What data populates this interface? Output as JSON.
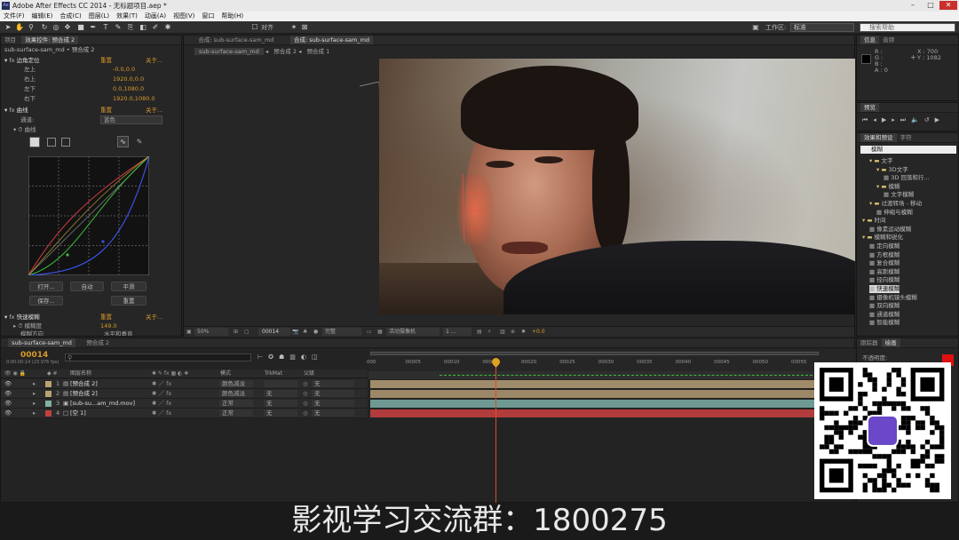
{
  "window": {
    "title": "Adobe After Effects CC 2014 - 无标题项目.aep *",
    "app_icon": "Ae",
    "minimize": "–",
    "maximize": "□",
    "close": "✕"
  },
  "menu": [
    "文件(F)",
    "编辑(E)",
    "合成(C)",
    "图层(L)",
    "效果(T)",
    "动画(A)",
    "视图(V)",
    "窗口",
    "帮助(H)"
  ],
  "toolbar": {
    "align_label": "对齐",
    "workspace_label": "工作区:",
    "workspace_value": "标准",
    "search_placeholder": "搜索帮助"
  },
  "effect_controls": {
    "tabs": [
      "项目",
      "效果控件: 预合成 2"
    ],
    "layer_path": "sub-surface-sam_md • 预合成 2",
    "corner_pin": {
      "name": "边角定位",
      "reset": "重置",
      "about": "关于...",
      "props": [
        {
          "label": "左上",
          "value": "-0.0,0.0"
        },
        {
          "label": "右上",
          "value": "1920.0,0.0"
        },
        {
          "label": "左下",
          "value": "0.0,1080.0"
        },
        {
          "label": "右下",
          "value": "1920.0,1080.0"
        }
      ]
    },
    "curves": {
      "name": "曲线",
      "reset": "重置",
      "about": "关于...",
      "channel_label": "通道:",
      "channel_value": "蓝色",
      "curve_label": "曲线",
      "buttons": {
        "open": "打开...",
        "auto": "自动",
        "smooth": "平滑",
        "save": "保存...",
        "reset": "重置"
      }
    },
    "fast_blur": {
      "name": "快速模糊",
      "reset": "重置",
      "about": "关于...",
      "blur_label": "模糊度",
      "blur_value": "149.0",
      "dimension_label": "模糊方向",
      "dimension_value": "水平和垂直"
    }
  },
  "composition": {
    "tabs": [
      "合成: sub-surface-sam_md",
      "合成: sub-surface-sam_md"
    ],
    "flow": [
      "sub-surface-sam_md",
      "预合成 2",
      "预合成 1"
    ],
    "footer": {
      "zoom": "50%",
      "timecode": "00014",
      "quality": "完整",
      "camera": "活动摄像机",
      "views": "1 ...",
      "exposure": "+0.0"
    }
  },
  "info_panel": {
    "tabs": [
      "信息",
      "音频"
    ],
    "r": "R :",
    "g": "G :",
    "b": "B :",
    "a": "A : 0",
    "x": "X : 700",
    "y": "Y : 1082"
  },
  "preview_panel": {
    "tab": "预览"
  },
  "effects_presets": {
    "tabs": [
      "效果和预设",
      "字符"
    ],
    "search_value": "模糊",
    "items": [
      {
        "label": "文字",
        "level": 1,
        "type": "folder"
      },
      {
        "label": "3D文字",
        "level": 2,
        "type": "folder"
      },
      {
        "label": "3D 回落和行...",
        "level": 3,
        "type": "preset"
      },
      {
        "label": "模糊",
        "level": 2,
        "type": "folder"
      },
      {
        "label": "文字模糊",
        "level": 3,
        "type": "preset"
      },
      {
        "label": "过渡转场 - 移动",
        "level": 1,
        "type": "folder"
      },
      {
        "label": "伸缩与模糊",
        "level": 2,
        "type": "preset"
      },
      {
        "label": "时间",
        "level": 0,
        "type": "folder"
      },
      {
        "label": "像素运动模糊",
        "level": 1,
        "type": "effect"
      },
      {
        "label": "模糊和锐化",
        "level": 0,
        "type": "folder"
      },
      {
        "label": "定向模糊",
        "level": 1,
        "type": "effect"
      },
      {
        "label": "方框模糊",
        "level": 1,
        "type": "effect"
      },
      {
        "label": "复合模糊",
        "level": 1,
        "type": "effect"
      },
      {
        "label": "高斯模糊",
        "level": 1,
        "type": "effect"
      },
      {
        "label": "径向模糊",
        "level": 1,
        "type": "effect"
      },
      {
        "label": "快速模糊",
        "level": 1,
        "type": "effect",
        "selected": true
      },
      {
        "label": "摄像机镜头模糊",
        "level": 1,
        "type": "effect"
      },
      {
        "label": "双向模糊",
        "level": 1,
        "type": "effect"
      },
      {
        "label": "通道模糊",
        "level": 1,
        "type": "effect"
      },
      {
        "label": "智能模糊",
        "level": 1,
        "type": "effect"
      }
    ]
  },
  "tracker_panel": {
    "tabs": [
      "跟踪器",
      "绘画"
    ],
    "label": "不透明度:"
  },
  "timeline": {
    "tabs": [
      "sub-surface-sam_md",
      "预合成 2"
    ],
    "timecode": "00014",
    "timecode_sub": "0:00:00:14 (23.976 fps)",
    "search_placeholder": "",
    "columns": {
      "layer_name": "图层名称",
      "mode": "模式",
      "trkmat": "TrkMat",
      "parent": "父级"
    },
    "ticks": [
      "000",
      "00005",
      "00010",
      "00015",
      "00020",
      "00025",
      "00030",
      "00035",
      "00040",
      "00045",
      "00050",
      "00055"
    ],
    "layers": [
      {
        "num": "1",
        "name": "[预合成 2]",
        "mode": "颜色减淡",
        "trkmat": "",
        "parent": "无",
        "color": "#b9a36e"
      },
      {
        "num": "2",
        "name": "[预合成 2]",
        "mode": "颜色减淡",
        "trkmat": "无",
        "parent": "无",
        "color": "#b9a36e"
      },
      {
        "num": "3",
        "name": "[sub-su...am_md.mov]",
        "mode": "正常",
        "trkmat": "无",
        "parent": "无",
        "color": "#7fb2a4"
      },
      {
        "num": "4",
        "name": "[空 1]",
        "mode": "正常",
        "trkmat": "无",
        "parent": "无",
        "color": "#c04040"
      }
    ],
    "playhead": 0.2941
  },
  "overlay_caption": "影视学习交流群：1800275",
  "colors": {
    "orange": "#d99a2b",
    "playhead": "#e0a020"
  }
}
